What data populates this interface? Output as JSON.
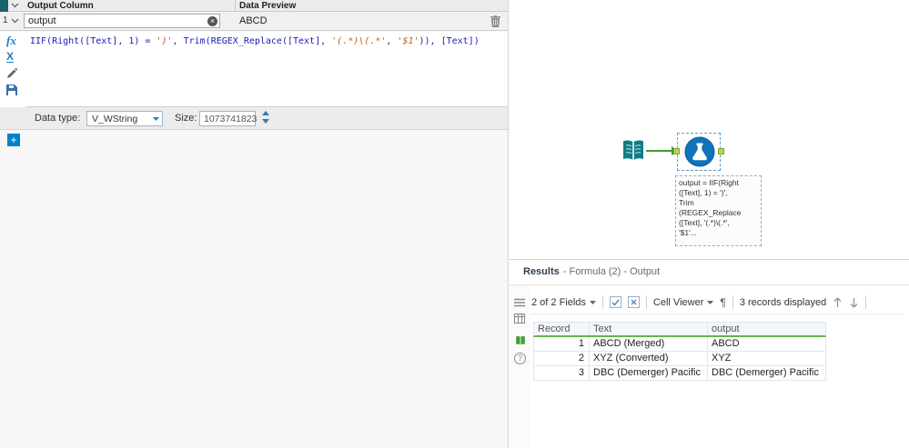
{
  "left_panel": {
    "header": {
      "output_column": "Output Column",
      "data_preview": "Data Preview"
    },
    "row": {
      "number": "1",
      "output_name": "output",
      "preview": "ABCD"
    },
    "formula": {
      "seg1": "IIF(Right([Text], 1) = ",
      "str1": "')'",
      "seg2": ", Trim(REGEX_Replace([Text], ",
      "str2": "'(.*)\\(.*'",
      "seg3": ", ",
      "str3": "'$1'",
      "seg4": ")), [Text])"
    },
    "datatype": {
      "label": "Data type:",
      "value": "V_WString",
      "size_label": "Size:",
      "size_value": "1073741823"
    }
  },
  "canvas": {
    "annotation": "output = IIF(Right\n([Text], 1) = ')',\nTrim\n(REGEX_Replace\n([Text], '(.*)\\(.*',\n'$1'..."
  },
  "results": {
    "title_bold": "Results",
    "title_rest": "- Formula (2) - Output",
    "toolbar": {
      "fields": "2 of 2 Fields",
      "cell_viewer": "Cell Viewer",
      "records": "3 records displayed"
    },
    "table": {
      "headers": [
        "Record",
        "Text",
        "output"
      ],
      "rows": [
        {
          "record": "1",
          "text": "ABCD (Merged)",
          "output": "ABCD"
        },
        {
          "record": "2",
          "text": "XYZ (Converted)",
          "output": "XYZ"
        },
        {
          "record": "3",
          "text": "DBC (Demerger) Pacific",
          "output": "DBC (Demerger) Pacific"
        }
      ]
    }
  },
  "icons": {
    "clear": "×",
    "plus": "+",
    "pilcrow": "¶",
    "question": "?",
    "fx": "fx",
    "variable": "X"
  },
  "colors": {
    "accent_blue": "#0082c8",
    "tool_blue": "#1173ba",
    "teal": "#0d7c85",
    "wire_green": "#3f9c35",
    "grid_green": "#64b54e"
  }
}
